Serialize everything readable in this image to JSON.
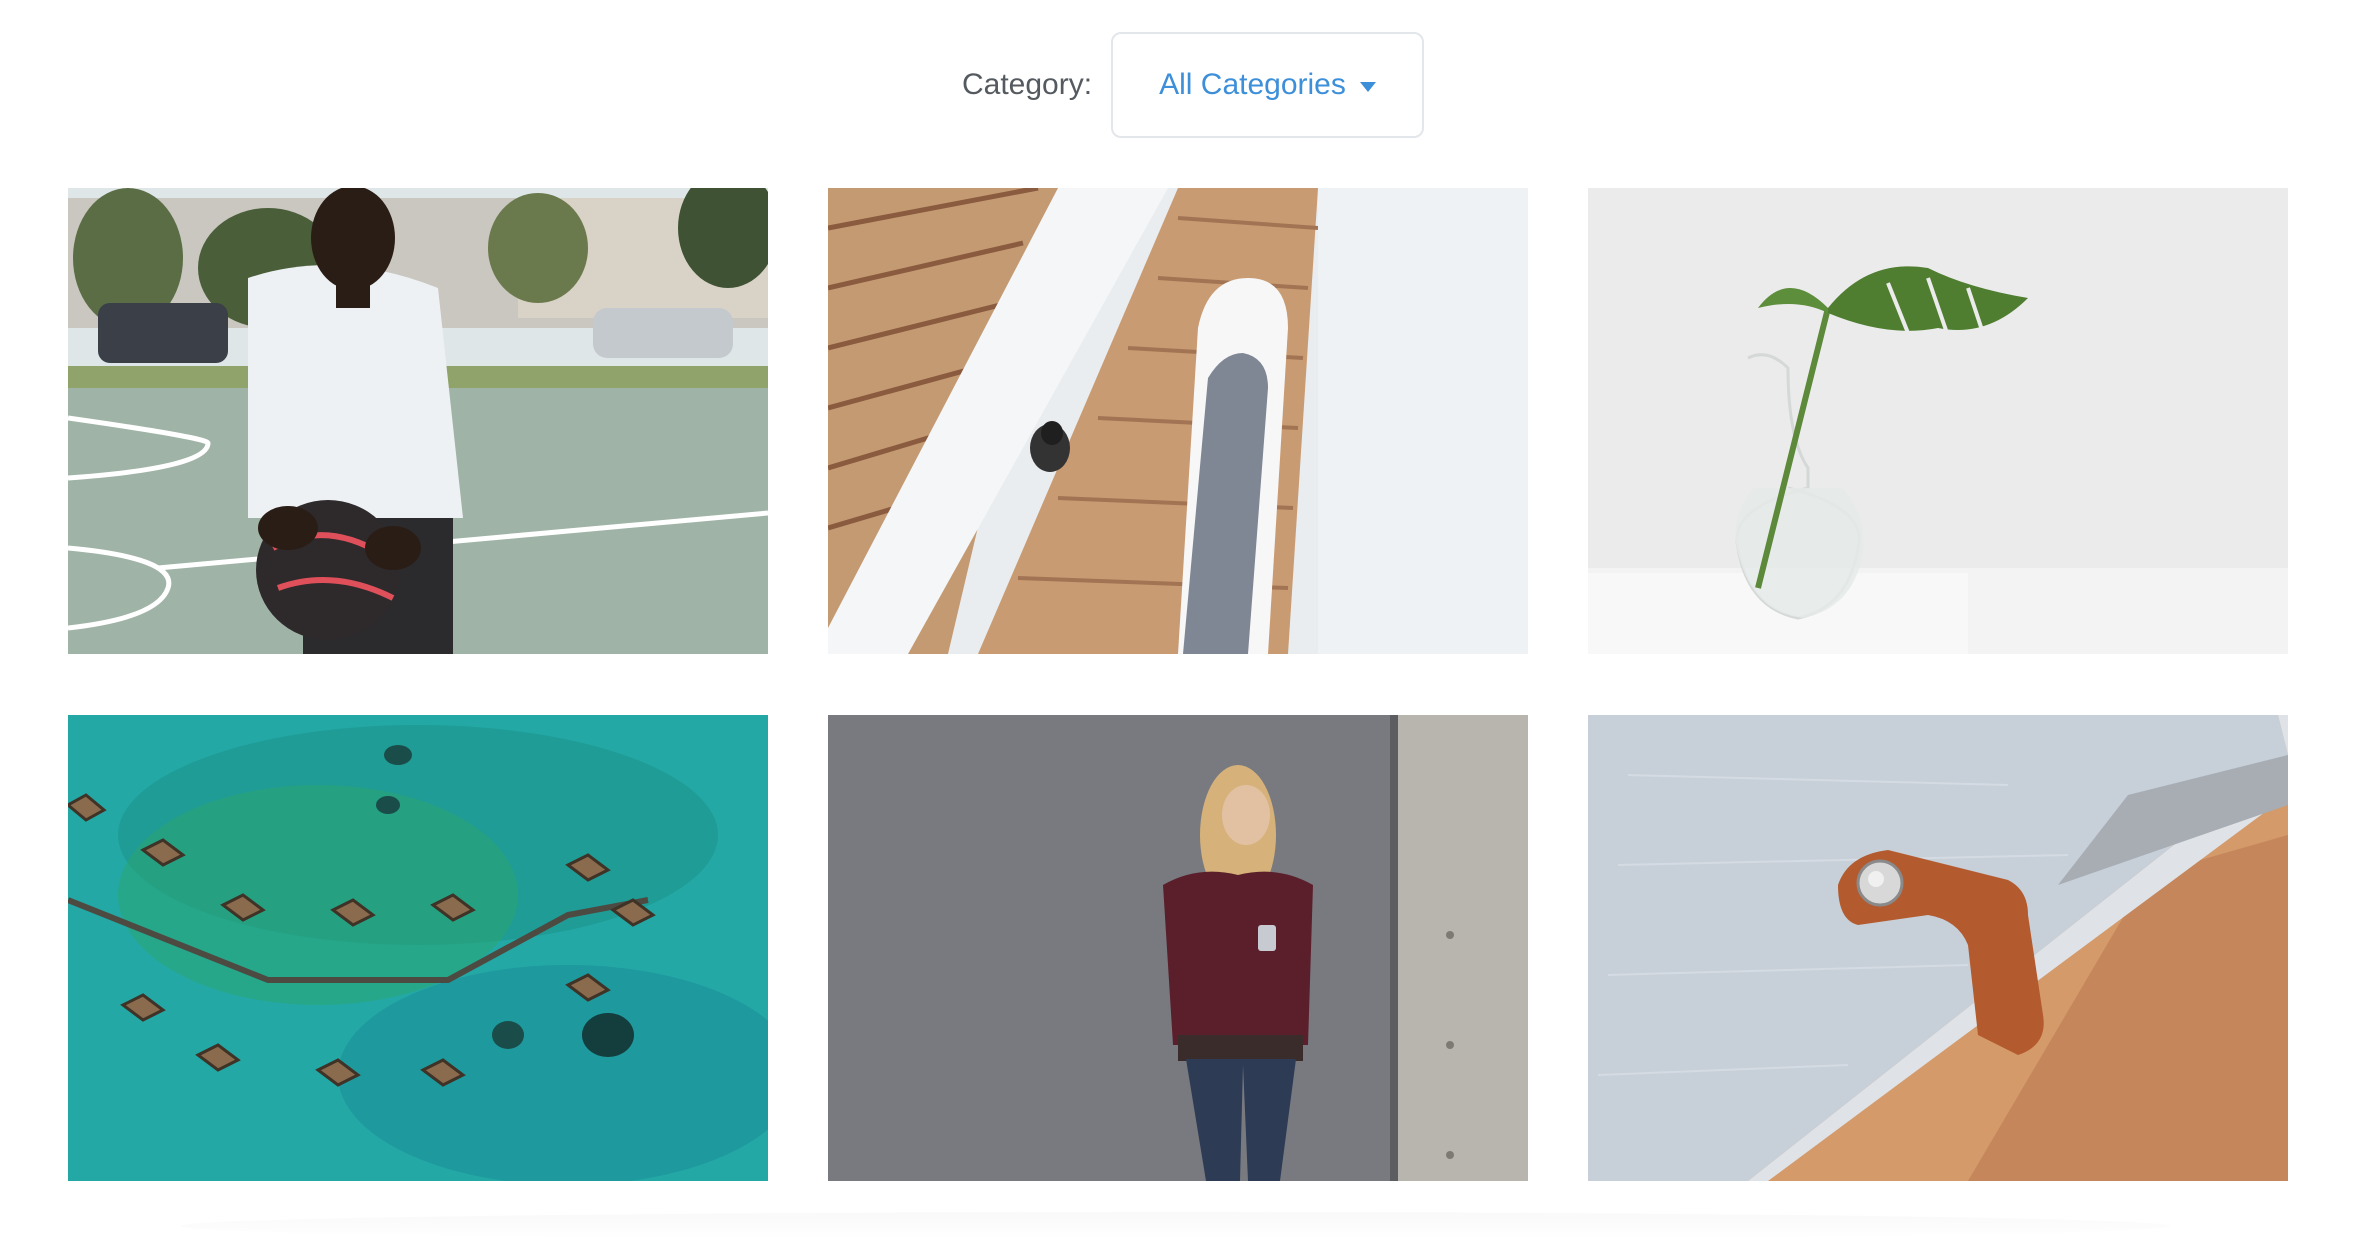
{
  "filter": {
    "label": "Category:",
    "selected": "All Categories"
  },
  "gallery": {
    "items": [
      {
        "name": "photo-basketball-player"
      },
      {
        "name": "photo-spiral-staircase"
      },
      {
        "name": "photo-plant-in-vase"
      },
      {
        "name": "photo-overwater-bungalows"
      },
      {
        "name": "photo-woman-with-phone"
      },
      {
        "name": "photo-laptop-sleeve"
      }
    ]
  },
  "colors": {
    "accent": "#3d8fd9",
    "label_text": "#555a60",
    "select_border": "#e3e6ea"
  }
}
